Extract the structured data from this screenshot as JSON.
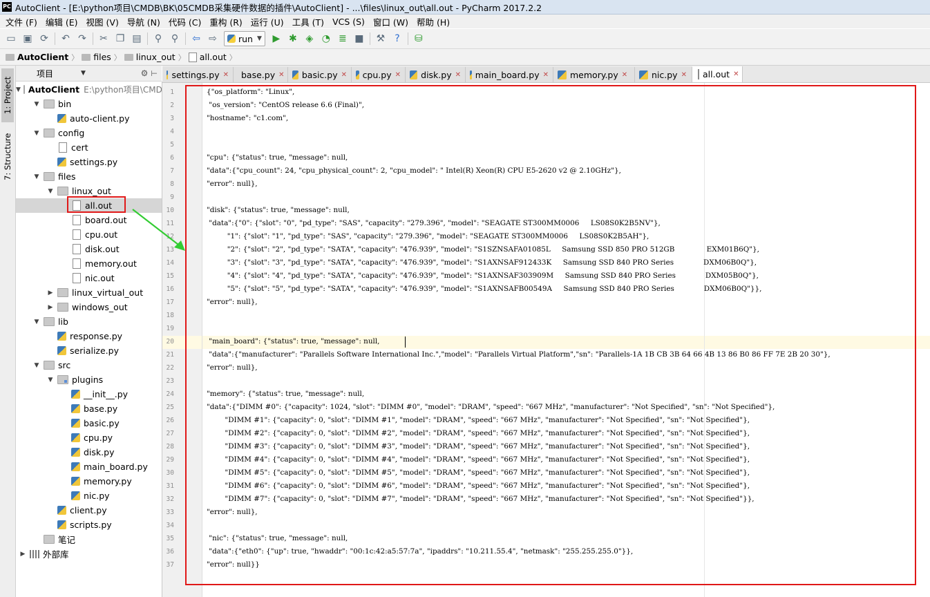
{
  "window": {
    "logo": "PC",
    "title": "AutoClient - [E:\\python项目\\CMDB\\BK\\05CMDB采集硬件数据的插件\\AutoClient] - ...\\files\\linux_out\\all.out - PyCharm 2017.2.2"
  },
  "menu": [
    "文件 (F)",
    "编辑 (E)",
    "视图 (V)",
    "导航 (N)",
    "代码 (C)",
    "重构 (R)",
    "运行 (U)",
    "工具 (T)",
    "VCS (S)",
    "窗口 (W)",
    "帮助 (H)"
  ],
  "toolbar": {
    "run_config": "run"
  },
  "breadcrumb": [
    "AutoClient",
    "files",
    "linux_out",
    "all.out"
  ],
  "left_strip": {
    "project_tab": "1: Project",
    "structure_tab": "7: Structure"
  },
  "project_panel": {
    "title": "项目",
    "root_path": "E:\\python项目\\CMDB\\BK\\05CMDB采集硬件数据的插件\\AutoClient",
    "tree": [
      {
        "label": "AutoClient",
        "level": 0,
        "type": "folder",
        "open": true,
        "bold": true
      },
      {
        "label": "bin",
        "level": 1,
        "type": "folder",
        "open": true
      },
      {
        "label": "auto-client.py",
        "level": 2,
        "type": "py"
      },
      {
        "label": "config",
        "level": 1,
        "type": "folder",
        "open": true
      },
      {
        "label": "cert",
        "level": 2,
        "type": "txt"
      },
      {
        "label": "settings.py",
        "level": 2,
        "type": "py"
      },
      {
        "label": "files",
        "level": 1,
        "type": "folder",
        "open": true
      },
      {
        "label": "linux_out",
        "level": 2,
        "type": "folder",
        "open": true
      },
      {
        "label": "all.out",
        "level": 3,
        "type": "txt",
        "selected": true
      },
      {
        "label": "board.out",
        "level": 3,
        "type": "txt"
      },
      {
        "label": "cpu.out",
        "level": 3,
        "type": "txt"
      },
      {
        "label": "disk.out",
        "level": 3,
        "type": "txt"
      },
      {
        "label": "memory.out",
        "level": 3,
        "type": "txt"
      },
      {
        "label": "nic.out",
        "level": 3,
        "type": "txt"
      },
      {
        "label": "linux_virtual_out",
        "level": 2,
        "type": "folder",
        "open": false
      },
      {
        "label": "windows_out",
        "level": 2,
        "type": "folder",
        "open": false
      },
      {
        "label": "lib",
        "level": 1,
        "type": "folder",
        "open": true
      },
      {
        "label": "response.py",
        "level": 2,
        "type": "py"
      },
      {
        "label": "serialize.py",
        "level": 2,
        "type": "py"
      },
      {
        "label": "src",
        "level": 1,
        "type": "folder",
        "open": true
      },
      {
        "label": "plugins",
        "level": 2,
        "type": "pkg",
        "open": true
      },
      {
        "label": "__init__.py",
        "level": 3,
        "type": "py"
      },
      {
        "label": "base.py",
        "level": 3,
        "type": "py"
      },
      {
        "label": "basic.py",
        "level": 3,
        "type": "py"
      },
      {
        "label": "cpu.py",
        "level": 3,
        "type": "py"
      },
      {
        "label": "disk.py",
        "level": 3,
        "type": "py"
      },
      {
        "label": "main_board.py",
        "level": 3,
        "type": "py"
      },
      {
        "label": "memory.py",
        "level": 3,
        "type": "py"
      },
      {
        "label": "nic.py",
        "level": 3,
        "type": "py"
      },
      {
        "label": "client.py",
        "level": 2,
        "type": "py"
      },
      {
        "label": "scripts.py",
        "level": 2,
        "type": "py"
      },
      {
        "label": "笔记",
        "level": 1,
        "type": "folder"
      },
      {
        "label": "外部库",
        "level": 0,
        "type": "lib",
        "open": false
      }
    ]
  },
  "tabs": [
    {
      "label": "settings.py",
      "type": "py"
    },
    {
      "label": "base.py",
      "type": "py"
    },
    {
      "label": "basic.py",
      "type": "py"
    },
    {
      "label": "cpu.py",
      "type": "py"
    },
    {
      "label": "disk.py",
      "type": "py"
    },
    {
      "label": "main_board.py",
      "type": "py"
    },
    {
      "label": "memory.py",
      "type": "py"
    },
    {
      "label": "nic.py",
      "type": "py"
    },
    {
      "label": "all.out",
      "type": "txt",
      "active": true
    }
  ],
  "editor": {
    "current_line": 20,
    "lines": [
      "{\"os_platform\": \"Linux\",",
      " \"os_version\": \"CentOS release 6.6 (Final)\",",
      "\"hostname\": \"c1.com\",",
      "",
      "",
      "\"cpu\": {\"status\": true, \"message\": null,",
      "\"data\":{\"cpu_count\": 24, \"cpu_physical_count\": 2, \"cpu_model\": \" Intel(R) Xeon(R) CPU E5-2620 v2 @ 2.10GHz\"},",
      "\"error\": null},",
      "",
      "\"disk\": {\"status\": true, \"message\": null,",
      " \"data\":{\"0\": {\"slot\": \"0\", \"pd_type\": \"SAS\", \"capacity\": \"279.396\", \"model\": \"SEAGATE ST300MM0006     LS08S0K2B5NV\"},",
      "         \"1\": {\"slot\": \"1\", \"pd_type\": \"SAS\", \"capacity\": \"279.396\", \"model\": \"SEAGATE ST300MM0006     LS08S0K2B5AH\"},",
      "         \"2\": {\"slot\": \"2\", \"pd_type\": \"SATA\", \"capacity\": \"476.939\", \"model\": \"S1SZNSAFA01085L     Samsung SSD 850 PRO 512GB              EXM01B6Q\"},",
      "         \"3\": {\"slot\": \"3\", \"pd_type\": \"SATA\", \"capacity\": \"476.939\", \"model\": \"S1AXNSAF912433K     Samsung SSD 840 PRO Series             DXM06B0Q\"},",
      "         \"4\": {\"slot\": \"4\", \"pd_type\": \"SATA\", \"capacity\": \"476.939\", \"model\": \"S1AXNSAF303909M     Samsung SSD 840 PRO Series             DXM05B0Q\"},",
      "         \"5\": {\"slot\": \"5\", \"pd_type\": \"SATA\", \"capacity\": \"476.939\", \"model\": \"S1AXNSAFB00549A     Samsung SSD 840 PRO Series             DXM06B0Q\"}},",
      "\"error\": null},",
      "",
      "",
      " \"main_board\": {\"status\": true, \"message\": null,",
      " \"data\":{\"manufacturer\": \"Parallels Software International Inc.\",\"model\": \"Parallels Virtual Platform\",\"sn\": \"Parallels-1A 1B CB 3B 64 66 4B 13 86 B0 86 FF 7E 2B 20 30\"},",
      "\"error\": null},",
      "",
      "\"memory\": {\"status\": true, \"message\": null,",
      "\"data\":{\"DIMM #0\": {\"capacity\": 1024, \"slot\": \"DIMM #0\", \"model\": \"DRAM\", \"speed\": \"667 MHz\", \"manufacturer\": \"Not Specified\", \"sn\": \"Not Specified\"},",
      "        \"DIMM #1\": {\"capacity\": 0, \"slot\": \"DIMM #1\", \"model\": \"DRAM\", \"speed\": \"667 MHz\", \"manufacturer\": \"Not Specified\", \"sn\": \"Not Specified\"},",
      "        \"DIMM #2\": {\"capacity\": 0, \"slot\": \"DIMM #2\", \"model\": \"DRAM\", \"speed\": \"667 MHz\", \"manufacturer\": \"Not Specified\", \"sn\": \"Not Specified\"},",
      "        \"DIMM #3\": {\"capacity\": 0, \"slot\": \"DIMM #3\", \"model\": \"DRAM\", \"speed\": \"667 MHz\", \"manufacturer\": \"Not Specified\", \"sn\": \"Not Specified\"},",
      "        \"DIMM #4\": {\"capacity\": 0, \"slot\": \"DIMM #4\", \"model\": \"DRAM\", \"speed\": \"667 MHz\", \"manufacturer\": \"Not Specified\", \"sn\": \"Not Specified\"},",
      "        \"DIMM #5\": {\"capacity\": 0, \"slot\": \"DIMM #5\", \"model\": \"DRAM\", \"speed\": \"667 MHz\", \"manufacturer\": \"Not Specified\", \"sn\": \"Not Specified\"},",
      "        \"DIMM #6\": {\"capacity\": 0, \"slot\": \"DIMM #6\", \"model\": \"DRAM\", \"speed\": \"667 MHz\", \"manufacturer\": \"Not Specified\", \"sn\": \"Not Specified\"},",
      "        \"DIMM #7\": {\"capacity\": 0, \"slot\": \"DIMM #7\", \"model\": \"DRAM\", \"speed\": \"667 MHz\", \"manufacturer\": \"Not Specified\", \"sn\": \"Not Specified\"}},",
      "\"error\": null},",
      "",
      " \"nic\": {\"status\": true, \"message\": null,",
      " \"data\":{\"eth0\": {\"up\": true, \"hwaddr\": \"00:1c:42:a5:57:7a\", \"ipaddrs\": \"10.211.55.4\", \"netmask\": \"255.255.255.0\"}},",
      "\"error\": null}}"
    ]
  },
  "annotations": {
    "box_color": "#e01818",
    "arrow_color": "#33cc33"
  }
}
